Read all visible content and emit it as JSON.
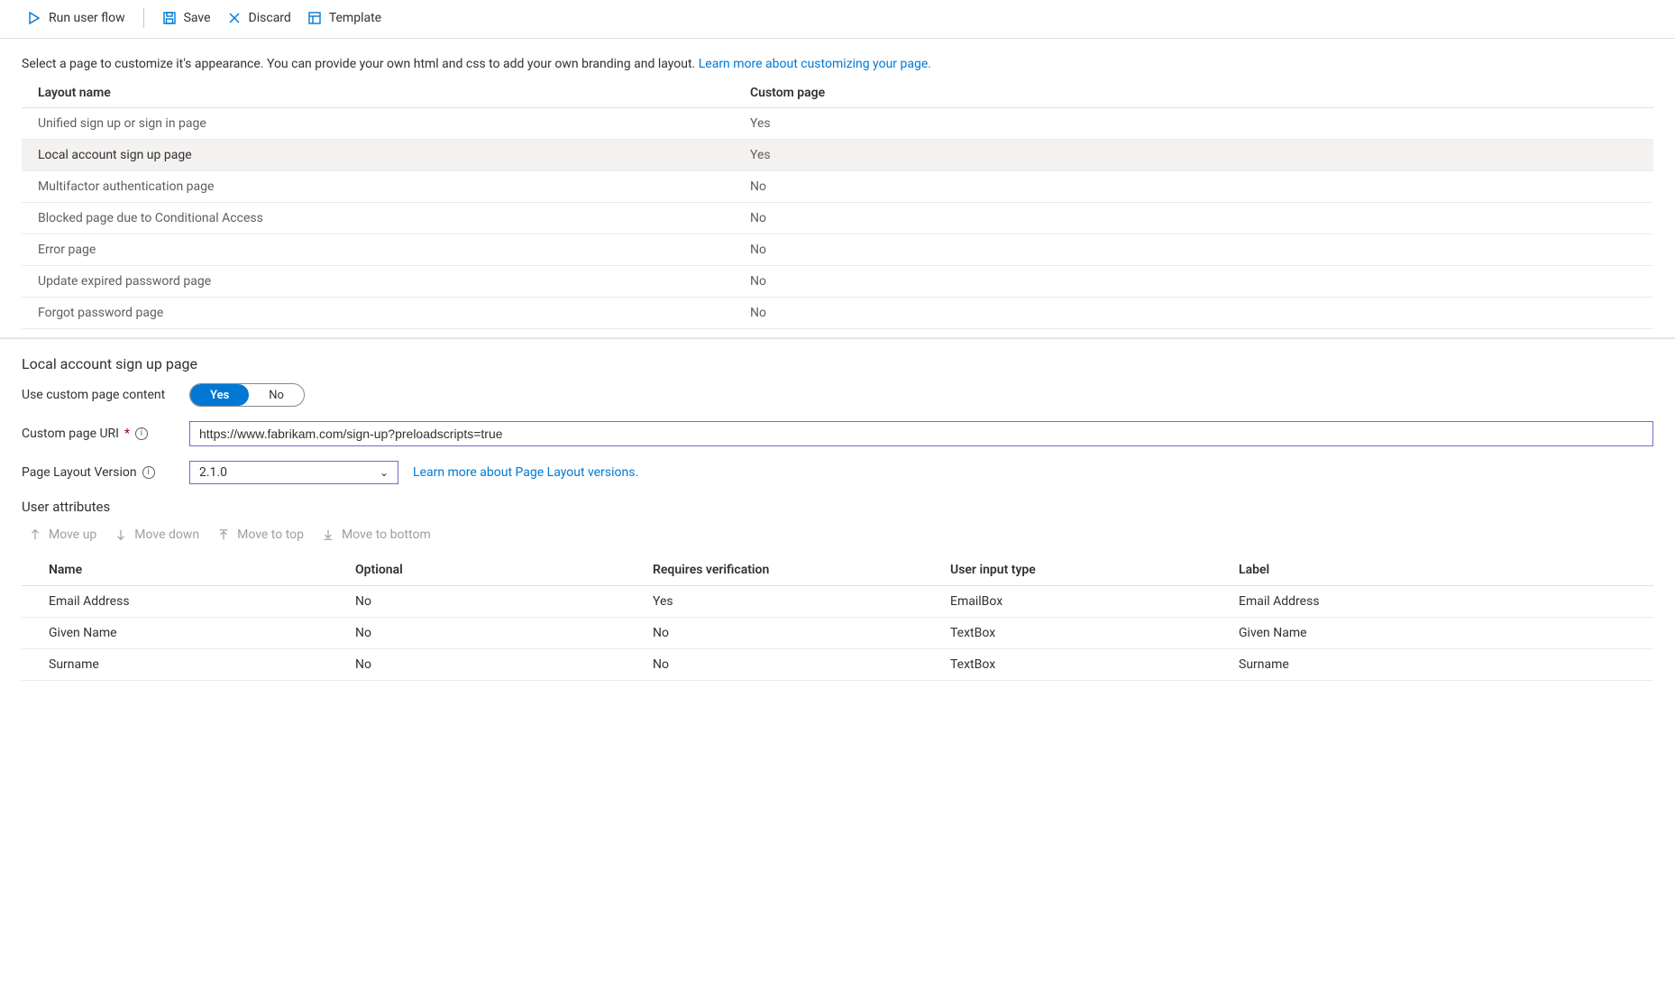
{
  "toolbar": {
    "run_label": "Run user flow",
    "save_label": "Save",
    "discard_label": "Discard",
    "template_label": "Template"
  },
  "intro": {
    "text": "Select a page to customize it's appearance. You can provide your own html and css to add your own branding and layout. ",
    "link_text": "Learn more about customizing your page."
  },
  "layouts": {
    "col_name": "Layout name",
    "col_custom": "Custom page",
    "rows": [
      {
        "name": "Unified sign up or sign in page",
        "custom": "Yes",
        "selected": false
      },
      {
        "name": "Local account sign up page",
        "custom": "Yes",
        "selected": true
      },
      {
        "name": "Multifactor authentication page",
        "custom": "No",
        "selected": false
      },
      {
        "name": "Blocked page due to Conditional Access",
        "custom": "No",
        "selected": false
      },
      {
        "name": "Error page",
        "custom": "No",
        "selected": false
      },
      {
        "name": "Update expired password page",
        "custom": "No",
        "selected": false
      },
      {
        "name": "Forgot password page",
        "custom": "No",
        "selected": false
      }
    ]
  },
  "detail": {
    "title": "Local account sign up page",
    "use_custom_label": "Use custom page content",
    "toggle_yes": "Yes",
    "toggle_no": "No",
    "uri_label": "Custom page URI",
    "uri_value": "https://www.fabrikam.com/sign-up?preloadscripts=true",
    "version_label": "Page Layout Version",
    "version_value": "2.1.0",
    "version_link": "Learn more about Page Layout versions."
  },
  "user_attributes": {
    "title": "User attributes",
    "toolbar": {
      "move_up": "Move up",
      "move_down": "Move down",
      "move_top": "Move to top",
      "move_bottom": "Move to bottom"
    },
    "cols": {
      "name": "Name",
      "optional": "Optional",
      "verify": "Requires verification",
      "input": "User input type",
      "label": "Label"
    },
    "rows": [
      {
        "name": "Email Address",
        "optional": "No",
        "verify": "Yes",
        "input": "EmailBox",
        "label": "Email Address"
      },
      {
        "name": "Given Name",
        "optional": "No",
        "verify": "No",
        "input": "TextBox",
        "label": "Given Name"
      },
      {
        "name": "Surname",
        "optional": "No",
        "verify": "No",
        "input": "TextBox",
        "label": "Surname"
      }
    ]
  }
}
